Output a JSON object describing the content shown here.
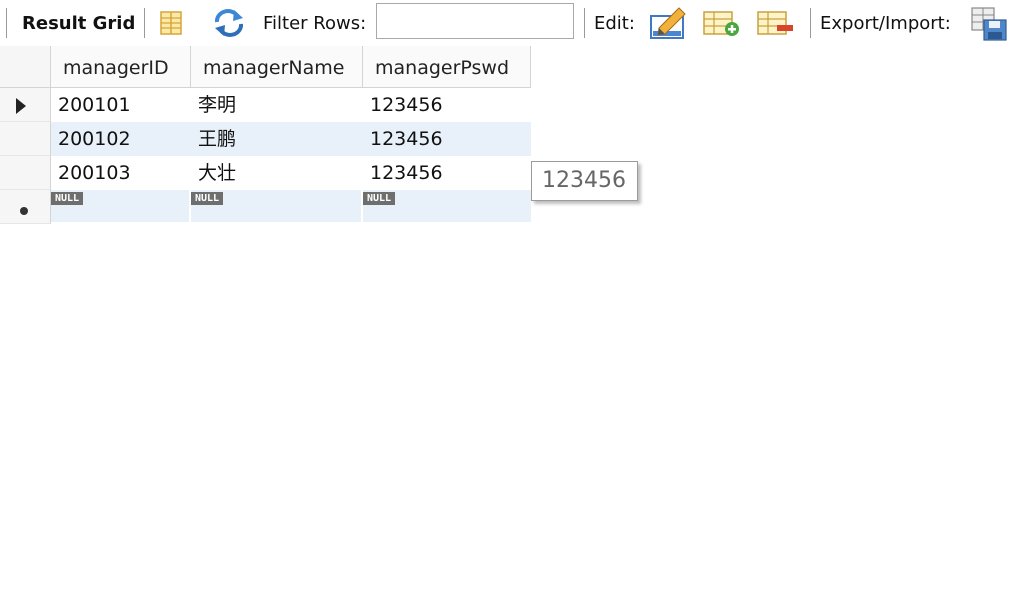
{
  "toolbar": {
    "result_grid_label": "Result Grid",
    "filter_rows_label": "Filter Rows:",
    "filter_value": "",
    "edit_label": "Edit:",
    "export_import_label": "Export/Import:"
  },
  "grid": {
    "columns": [
      "managerID",
      "managerName",
      "managerPswd"
    ],
    "rows": [
      [
        "200101",
        "李明",
        "123456"
      ],
      [
        "200102",
        "王鹏",
        "123456"
      ],
      [
        "200103",
        "大壮",
        "123456"
      ]
    ],
    "null_label": "NULL"
  },
  "tooltip": {
    "text": "123456"
  }
}
